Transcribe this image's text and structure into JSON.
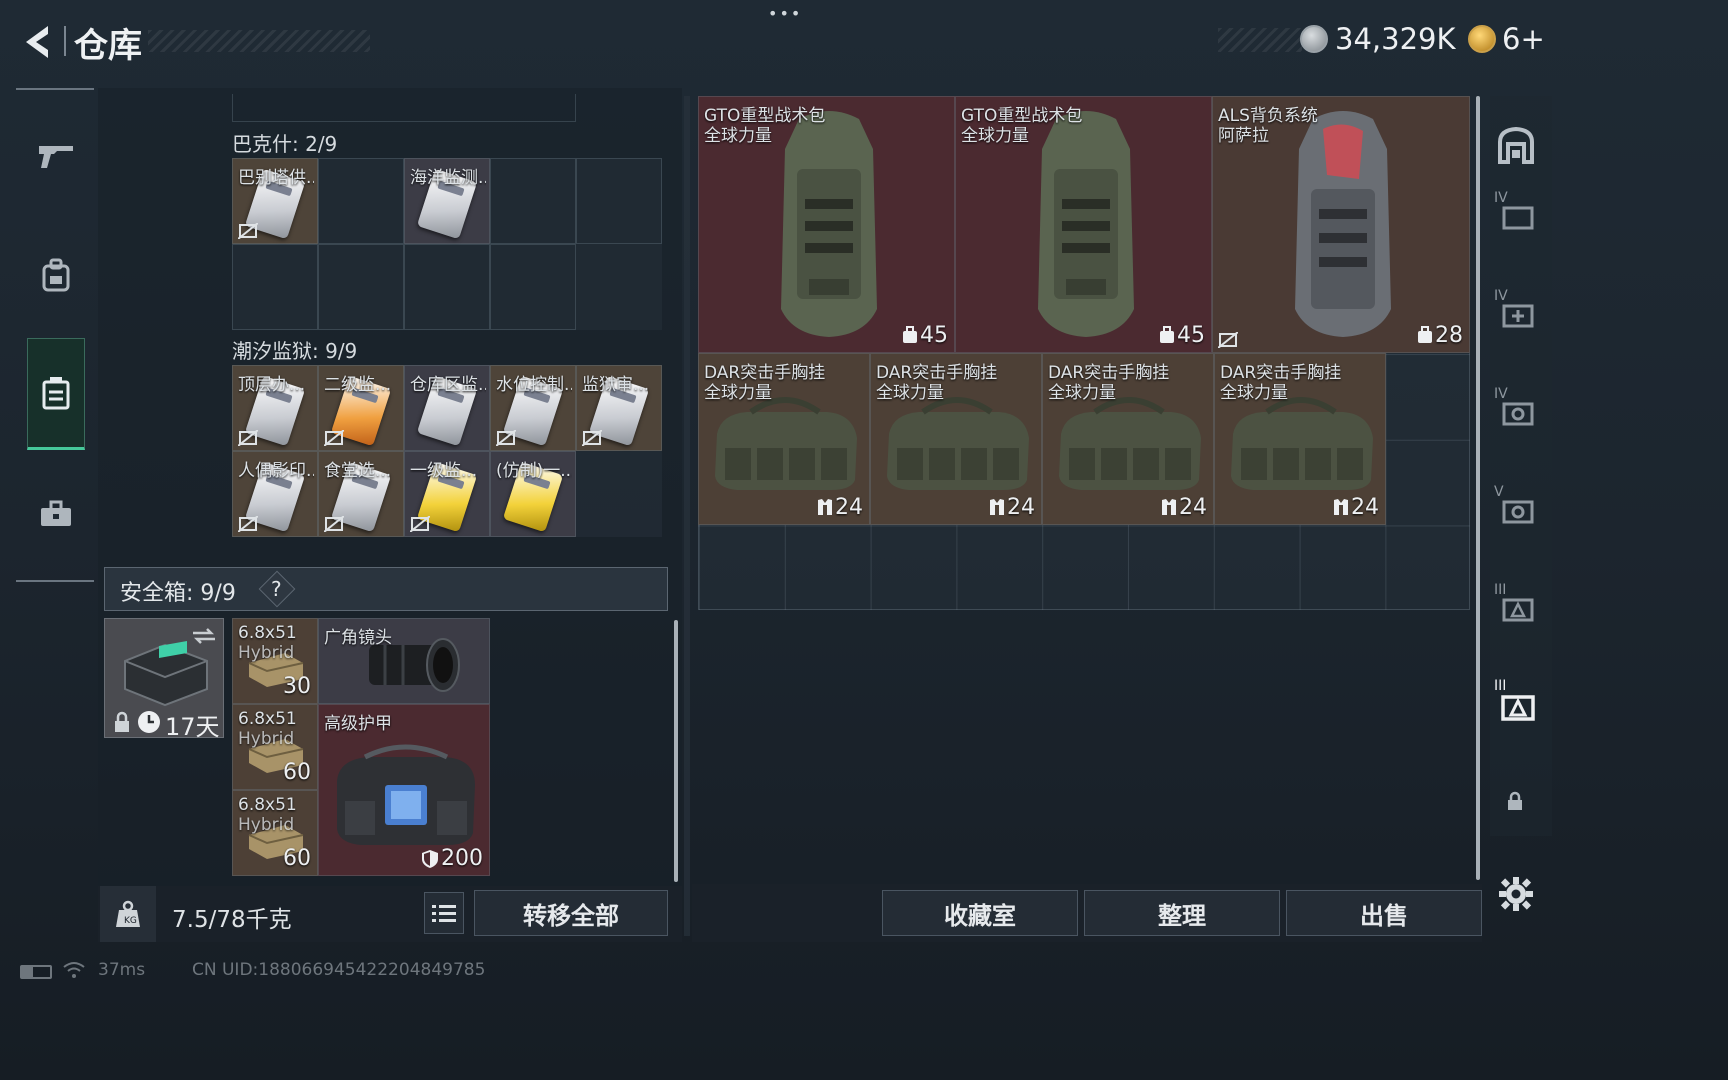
{
  "header": {
    "title": "仓库",
    "currency": "34,329K",
    "tickets": "6+",
    "dots": "•••"
  },
  "left_nav": [
    "weapon-icon",
    "backpack-icon",
    "case-icon",
    "toolbox-icon"
  ],
  "bakeshi": {
    "title": "巴克什: 2/9",
    "items": [
      {
        "name": "巴别塔供..."
      },
      {
        "name": "海洋监测..."
      }
    ]
  },
  "chaoxi": {
    "title": "潮汐监狱: 9/9",
    "items": [
      {
        "name": "顶层办..."
      },
      {
        "name": "二级监..."
      },
      {
        "name": "仓库区监..."
      },
      {
        "name": "水位控制..."
      },
      {
        "name": "监狱审..."
      },
      {
        "name": "人偶影印..."
      },
      {
        "name": "食堂选..."
      },
      {
        "name": "一级监..."
      },
      {
        "name": "(仿制)一..."
      }
    ]
  },
  "safe_box": {
    "title": "安全箱: 9/9",
    "help": "?",
    "timer": "17天",
    "ammo": [
      {
        "name": "6.8x51",
        "sub": "Hybrid",
        "count": "30"
      },
      {
        "name": "6.8x51",
        "sub": "Hybrid",
        "count": "60"
      },
      {
        "name": "6.8x51",
        "sub": "Hybrid",
        "count": "60"
      }
    ],
    "lens": {
      "name": "广角镜头"
    },
    "armor": {
      "name": "高级护甲",
      "count": "200"
    }
  },
  "left_footer": {
    "weight": "7.5/78千克",
    "transfer": "转移全部"
  },
  "backpacks": [
    {
      "name": "GTO重型战术包",
      "brand": "全球力量",
      "count": "45"
    },
    {
      "name": "GTO重型战术包",
      "brand": "全球力量",
      "count": "45"
    },
    {
      "name": "ALS背负系统",
      "brand": "阿萨拉",
      "count": "28"
    }
  ],
  "rigs": [
    {
      "name": "DAR突击手胸挂",
      "brand": "全球力量",
      "count": "24"
    },
    {
      "name": "DAR突击手胸挂",
      "brand": "全球力量",
      "count": "24"
    },
    {
      "name": "DAR突击手胸挂",
      "brand": "全球力量",
      "count": "24"
    },
    {
      "name": "DAR突击手胸挂",
      "brand": "全球力量",
      "count": "24"
    }
  ],
  "right_nav": {
    "labels": [
      "IV",
      "IV",
      "IV",
      "V",
      "III",
      "III"
    ]
  },
  "bottom_buttons": {
    "collection": "收藏室",
    "sort": "整理",
    "sell": "出售"
  },
  "status": {
    "ping": "37ms",
    "uid": "CN UID:18806694542220484978​5"
  }
}
